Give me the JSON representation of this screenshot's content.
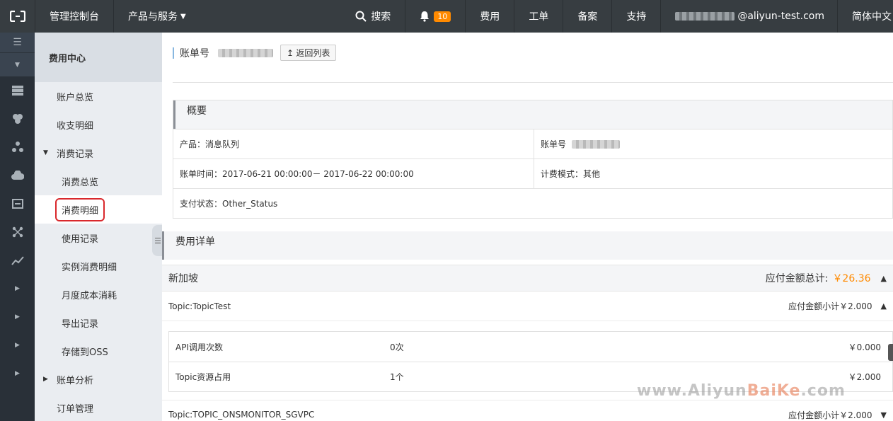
{
  "topbar": {
    "console": "管理控制台",
    "products": "产品与服务",
    "search": "搜索",
    "notif_count": "10",
    "fee": "费用",
    "ticket": "工单",
    "filing": "备案",
    "support": "支持",
    "account_suffix": "@aliyun-test.com",
    "language": "简体中文"
  },
  "sidebar": {
    "title": "费用中心",
    "items": [
      {
        "label": "账户总览"
      },
      {
        "label": "收支明细"
      },
      {
        "label": "消费记录"
      },
      {
        "label": "消费总览"
      },
      {
        "label": "消费明细"
      },
      {
        "label": "使用记录"
      },
      {
        "label": "实例消费明细"
      },
      {
        "label": "月度成本消耗"
      },
      {
        "label": "导出记录"
      },
      {
        "label": "存储到OSS"
      },
      {
        "label": "账单分析"
      },
      {
        "label": "订单管理"
      }
    ]
  },
  "main": {
    "bill_label": "账单号",
    "back_button": "返回列表",
    "overview": {
      "title": "概要",
      "product": "产品：消息队列",
      "bill_no_label": "账单号",
      "bill_time": "账单时间：2017-06-21 00:00:00－ 2017-06-22 00:00:00",
      "billing_mode": "计费模式：其他",
      "pay_status": "支付状态：Other_Status"
    },
    "fee_details_title": "费用详单",
    "region": {
      "name": "新加坡",
      "total_label": "应付金额总计:",
      "total_value": "￥26.36"
    },
    "topics": [
      {
        "name": "Topic:TopicTest",
        "subtotal": "应付金额小计￥2.000",
        "items": [
          {
            "name": "API调用次数",
            "qty": "0次",
            "amount": "￥0.000"
          },
          {
            "name": "Topic资源占用",
            "qty": "1个",
            "amount": "￥2.000"
          }
        ]
      },
      {
        "name": "Topic:TOPIC_ONSMONITOR_SGVPC",
        "subtotal": "应付金额小计￥2.000"
      }
    ]
  },
  "watermark": {
    "part1": "www.Aliyun",
    "part2": "BaiKe",
    "part3": ".com"
  },
  "colors": {
    "topbar": "#373d41",
    "accent": "#ff8a00",
    "sidebar": "#eaedf1",
    "highlight": "#d9282c"
  }
}
